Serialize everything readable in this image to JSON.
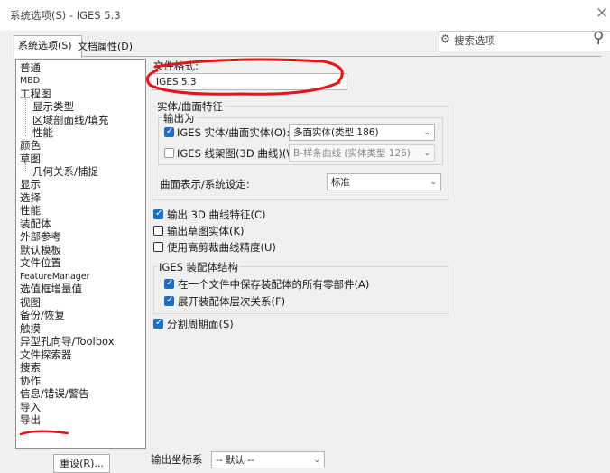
{
  "window": {
    "title": "系统选项(S) - IGES 5.3",
    "close": "✕"
  },
  "tabs": {
    "system": "系统选项(S)",
    "document": "文档属性(D)"
  },
  "search": {
    "placeholder": "搜索选项"
  },
  "tree": {
    "items": [
      "普通",
      "MBD",
      "工程图",
      "显示类型",
      "区域剖面线/填充",
      "性能",
      "颜色",
      "草图",
      "几何关系/捕捉",
      "显示",
      "选择",
      "性能",
      "装配体",
      "外部参考",
      "默认模板",
      "文件位置",
      "FeatureManager",
      "选值框增量值",
      "视图",
      "备份/恢复",
      "触摸",
      "异型孔向导/Toolbox",
      "文件探索器",
      "搜索",
      "协作",
      "信息/错误/警告",
      "导入",
      "导出"
    ]
  },
  "reset_button": "重设(R)...",
  "file_format": {
    "label": "文件格式:",
    "value": "IGES 5.3"
  },
  "solid_surface": {
    "title": "实体/曲面特征",
    "output_as_title": "输出为",
    "solids_label": "IGES 实体/曲面实体(O):",
    "solids_value": "多面实体(类型 186)",
    "wireframe_label": "IGES 线架图(3D 曲线)(W):",
    "wireframe_value": "B-样条曲线 (实体类型 126)",
    "surface_rep_label": "曲面表示/系统设定:",
    "surface_rep_value": "标准"
  },
  "options": {
    "export_3d_curves": "输出 3D 曲线特征(C)",
    "export_sketch": "输出草图实体(K)",
    "high_trim": "使用高剪裁曲线精度(U)"
  },
  "assembly": {
    "title": "IGES 装配体结构",
    "save_all": "在一个文件中保存装配体的所有零部件(A)",
    "flatten": "展开装配体层次关系(F)"
  },
  "split_periodic": "分割周期面(S)",
  "coord": {
    "label": "输出坐标系",
    "value": "-- 默认 --"
  }
}
